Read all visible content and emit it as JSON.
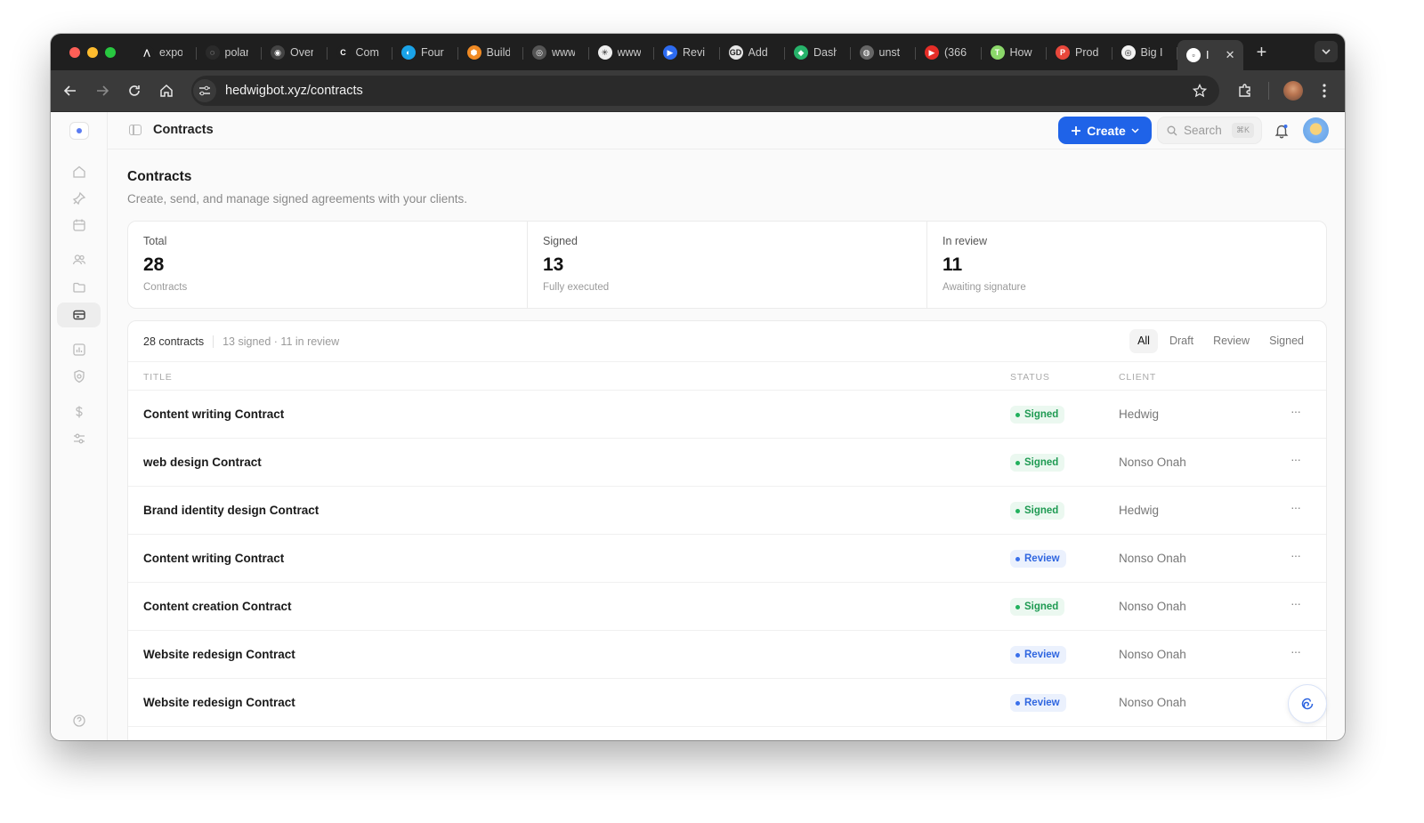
{
  "browser": {
    "tabs": [
      {
        "title": "expo",
        "color": "#1f1f1f",
        "glyph": "⋀"
      },
      {
        "title": "polar",
        "color": "#2a2a2a",
        "glyph": "◌"
      },
      {
        "title": "Overview",
        "color": "#444444",
        "glyph": "◉"
      },
      {
        "title": "Com",
        "color": "#1f1f1f",
        "glyph": "C"
      },
      {
        "title": "Four",
        "color": "#1aa3e8",
        "glyph": "◐"
      },
      {
        "title": "Build",
        "color": "#f08a24",
        "glyph": "⬢"
      },
      {
        "title": "www",
        "color": "#555555",
        "glyph": "◎"
      },
      {
        "title": "www",
        "color": "#eeeeee",
        "glyph": "✳"
      },
      {
        "title": "Revi",
        "color": "#2d6bf0",
        "glyph": "▶"
      },
      {
        "title": "Add",
        "color": "#e6e6e6",
        "glyph": "GD"
      },
      {
        "title": "Dash",
        "color": "#27b36a",
        "glyph": "◆"
      },
      {
        "title": "unst",
        "color": "#666666",
        "glyph": "◍"
      },
      {
        "title": "(366",
        "color": "#e52d27",
        "glyph": "▶"
      },
      {
        "title": "How",
        "color": "#8bd86a",
        "glyph": "T"
      },
      {
        "title": "Prod",
        "color": "#e8473b",
        "glyph": "P"
      },
      {
        "title": "Big I",
        "color": "#f2f2f2",
        "glyph": "◎"
      },
      {
        "title": "I",
        "color": "#ffffff",
        "glyph": "▫"
      }
    ],
    "new_tab_label": "+",
    "url": "hedwigbot.xyz/contracts"
  },
  "topbar": {
    "breadcrumb": "Contracts",
    "create_label": "Create",
    "search_placeholder": "Search",
    "search_shortcut": "⌘K"
  },
  "page": {
    "title": "Contracts",
    "subtitle": "Create, send, and manage signed agreements with your clients."
  },
  "stats": [
    {
      "label": "Total",
      "value": "28",
      "sub": "Contracts"
    },
    {
      "label": "Signed",
      "value": "13",
      "sub": "Fully executed"
    },
    {
      "label": "In review",
      "value": "11",
      "sub": "Awaiting signature"
    }
  ],
  "list": {
    "count_label": "28 contracts",
    "meta_label": "13 signed · 11 in review",
    "filters": [
      "All",
      "Draft",
      "Review",
      "Signed"
    ],
    "active_filter": "All",
    "columns": {
      "title": "TITLE",
      "status": "STATUS",
      "client": "CLIENT"
    },
    "rows": [
      {
        "title": "Content writing Contract",
        "status": "Signed",
        "client": "Hedwig"
      },
      {
        "title": "web design Contract",
        "status": "Signed",
        "client": "Nonso Onah"
      },
      {
        "title": "Brand identity design Contract",
        "status": "Signed",
        "client": "Hedwig"
      },
      {
        "title": "Content writing Contract",
        "status": "Review",
        "client": "Nonso Onah"
      },
      {
        "title": "Content creation Contract",
        "status": "Signed",
        "client": "Nonso Onah"
      },
      {
        "title": "Website redesign Contract",
        "status": "Review",
        "client": "Nonso Onah"
      },
      {
        "title": "Website redesign Contract",
        "status": "Review",
        "client": "Nonso Onah"
      }
    ],
    "row_menu_label": "···"
  },
  "colors": {
    "accent": "#1f63e8",
    "signed": "#1e9a52",
    "review": "#2f66e0"
  }
}
